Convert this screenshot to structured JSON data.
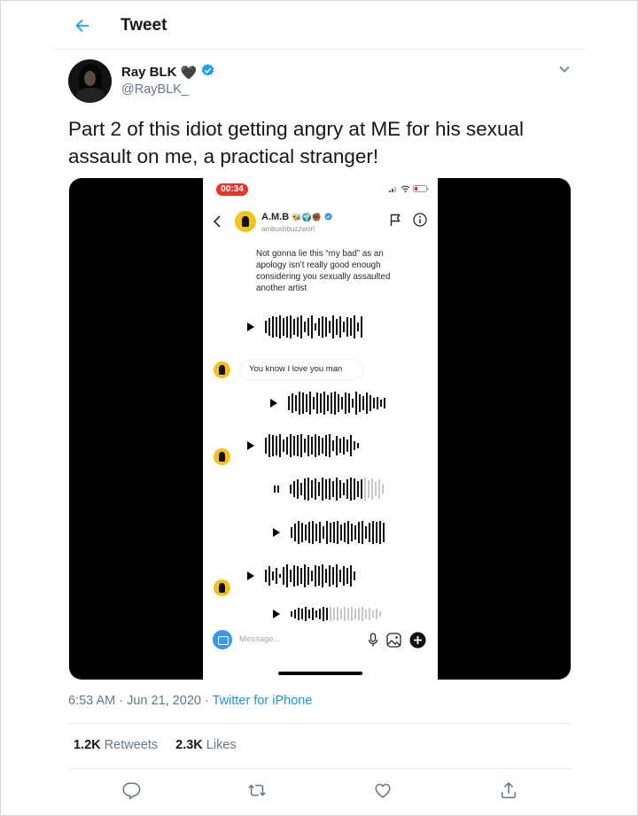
{
  "header": {
    "title": "Tweet"
  },
  "author": {
    "display_name": "Ray BLK",
    "heart": "🖤",
    "handle": "@RayBLK_"
  },
  "tweet": {
    "text": "Part 2 of this idiot getting angry at ME for his sexual assault on me, a practical stranger!"
  },
  "media": {
    "timer": "00:34",
    "chat_name": "A.M.B",
    "chat_emojis": "🐝🌍✊🏾",
    "chat_username": "ambushbuzzworl",
    "message_1": "Not gonna lie this “my bad” as an apology isn’t really good enough considering you sexually assaulted another artist",
    "message_2": "You know I love you man",
    "composer_placeholder": "Message..."
  },
  "meta": {
    "time": "6:53 AM",
    "date": "Jun 21, 2020",
    "separator": " · ",
    "source": "Twitter for iPhone"
  },
  "stats": {
    "retweets_count": "1.2K",
    "retweets_label": "Retweets",
    "likes_count": "2.3K",
    "likes_label": "Likes"
  },
  "colors": {
    "accent": "#1da1f2",
    "verified": "#1da1f2",
    "secondary_text": "#657786",
    "instagram_blue": "#3897f0"
  },
  "icons": [
    "back-arrow-icon",
    "verified-badge-icon",
    "chevron-down-icon",
    "reply-icon",
    "retweet-icon",
    "like-icon",
    "share-icon"
  ]
}
